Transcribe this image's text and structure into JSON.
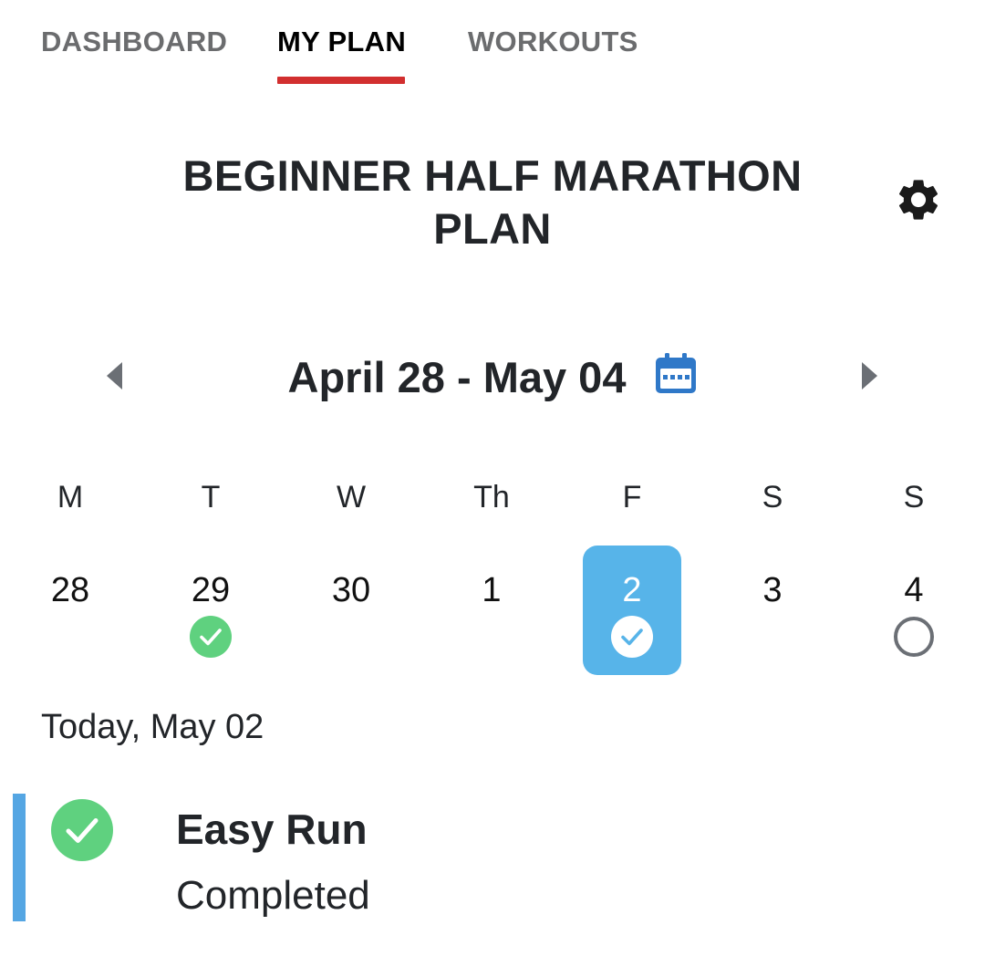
{
  "tabs": [
    {
      "label": "DASHBOARD",
      "active": false
    },
    {
      "label": "MY PLAN",
      "active": true
    },
    {
      "label": "WORKOUTS",
      "active": false
    }
  ],
  "plan": {
    "title": "BEGINNER HALF MARATHON PLAN",
    "settings_icon": "gear-icon"
  },
  "week_nav": {
    "range": "April 28 - May 04",
    "prev_icon": "caret-left-icon",
    "next_icon": "caret-right-icon",
    "calendar_icon": "calendar-icon"
  },
  "week": {
    "days": [
      {
        "weekday": "M",
        "date": "28",
        "status": "none",
        "selected": false
      },
      {
        "weekday": "T",
        "date": "29",
        "status": "completed",
        "selected": false
      },
      {
        "weekday": "W",
        "date": "30",
        "status": "none",
        "selected": false
      },
      {
        "weekday": "Th",
        "date": "1",
        "status": "none",
        "selected": false
      },
      {
        "weekday": "F",
        "date": "2",
        "status": "completed",
        "selected": true
      },
      {
        "weekday": "S",
        "date": "3",
        "status": "none",
        "selected": false
      },
      {
        "weekday": "S",
        "date": "4",
        "status": "scheduled",
        "selected": false
      }
    ]
  },
  "today": {
    "label": "Today, May 02",
    "workout": {
      "name": "Easy Run",
      "status": "Completed",
      "status_icon": "check-circle-icon"
    }
  },
  "colors": {
    "accent": "#d22f2f",
    "selected_day": "#57b4e9",
    "completed": "#5fd17f",
    "card_accent": "#55a6e3",
    "calendar_icon": "#2f78c8"
  }
}
